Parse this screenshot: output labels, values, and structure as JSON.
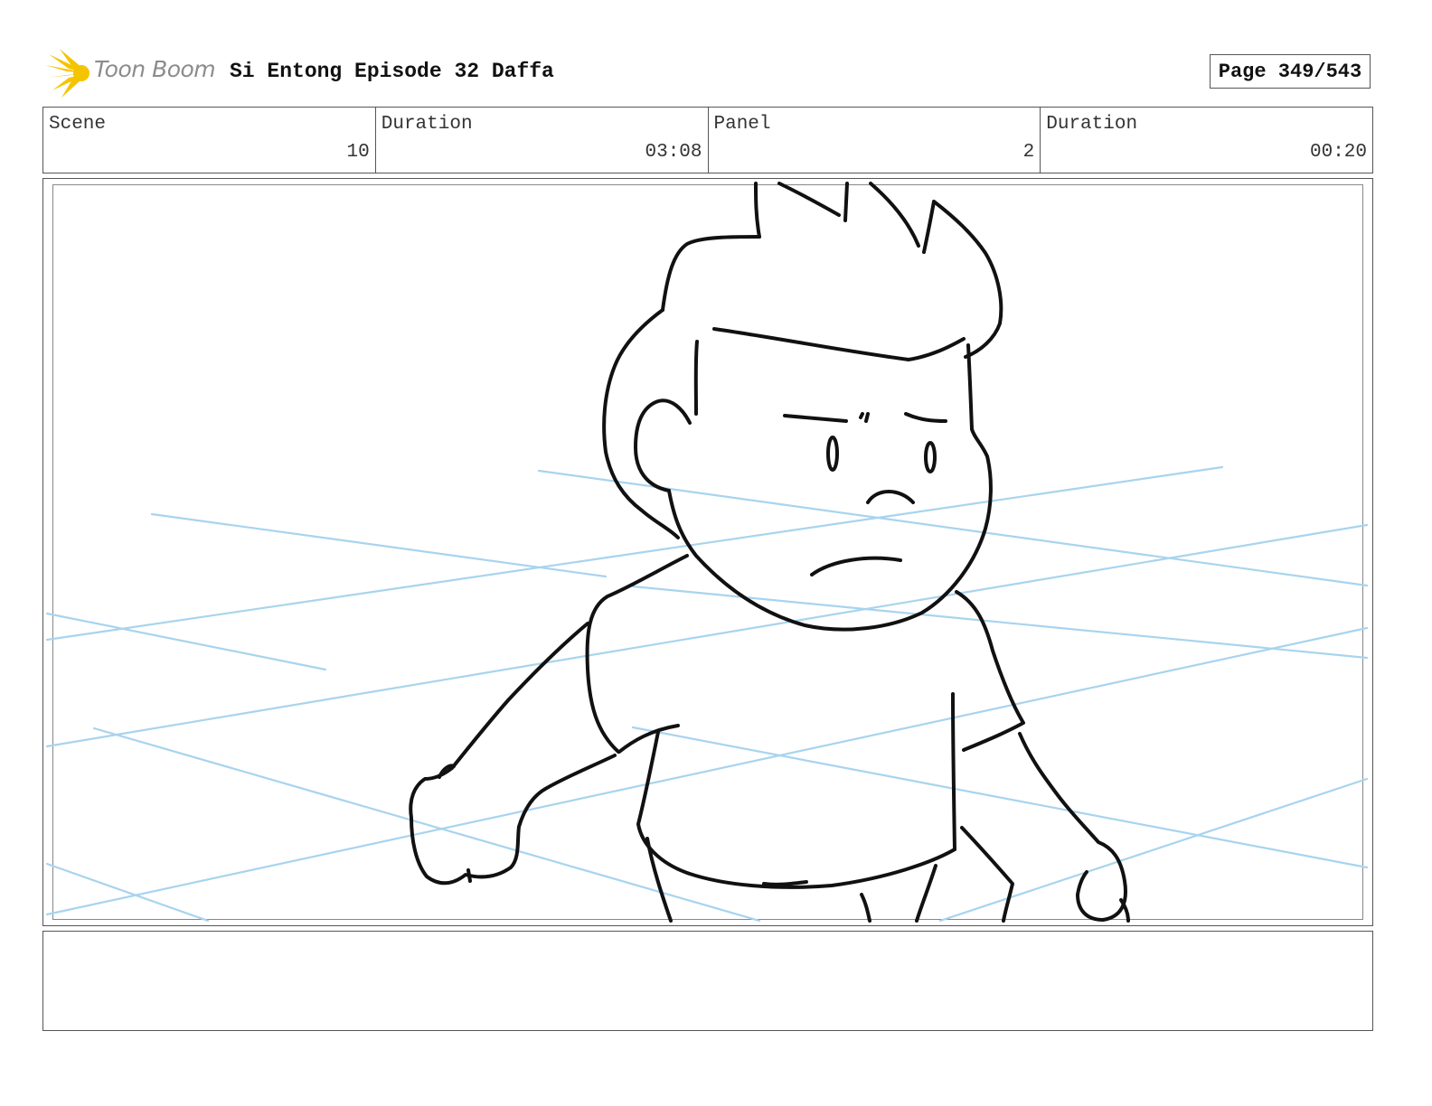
{
  "header": {
    "logo_text": "Toon Boom",
    "logo_color": "#f5c400",
    "project_title": "Si Entong Episode 32 Daffa",
    "page_label": "Page 349/543"
  },
  "info": [
    {
      "label": "Scene",
      "value": "10"
    },
    {
      "label": "Duration",
      "value": "03:08"
    },
    {
      "label": "Panel",
      "value": "2"
    },
    {
      "label": "Duration",
      "value": "00:20"
    }
  ],
  "panel": {
    "line_color": "#111111",
    "guide_color": "#a8d4ee"
  },
  "notes": ""
}
